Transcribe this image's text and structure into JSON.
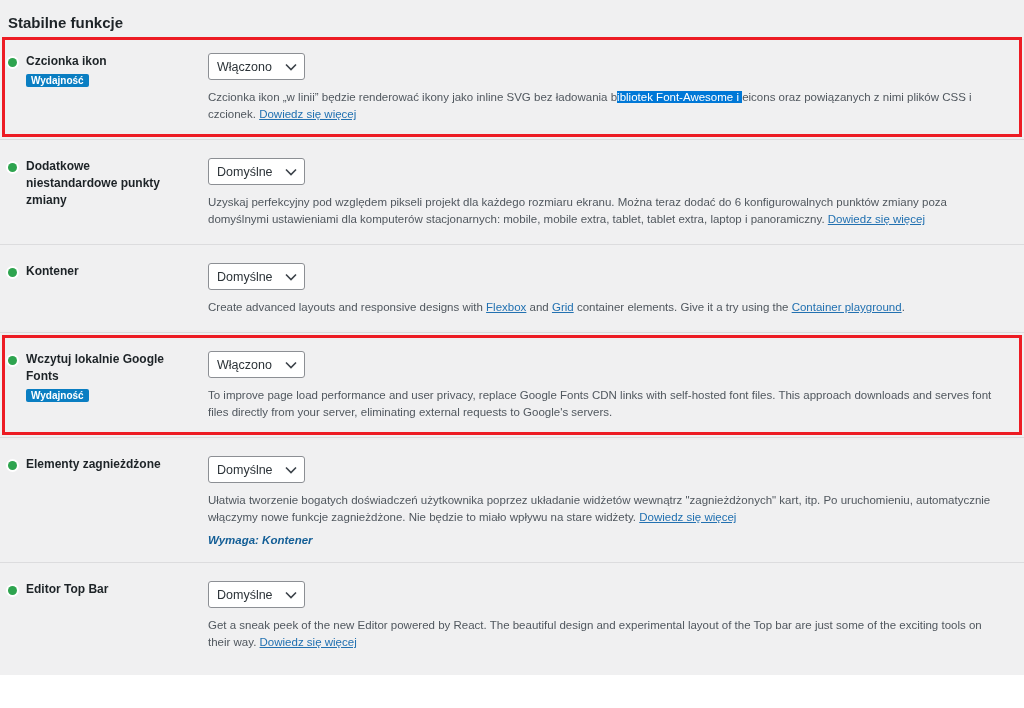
{
  "heading": "Stabilne funkcje",
  "features": [
    {
      "name": "Czcionka ikon",
      "tag": "Wydajność",
      "value": "Włączono",
      "framed": true,
      "description": [
        {
          "kind": "text",
          "text": "Czcionka ikon „w linii” będzie renderować ikony jako inline SVG bez ładowania b"
        },
        {
          "kind": "selection",
          "text": "ibliotek Font-Awesome i "
        },
        {
          "kind": "text",
          "text": "eicons oraz powiązanych z nimi plików CSS i czcionek. "
        },
        {
          "kind": "link",
          "text": "Dowiedz się więcej"
        }
      ]
    },
    {
      "name": "Dodatkowe niestandardowe punkty zmiany",
      "value": "Domyślne",
      "framed": false,
      "description": [
        {
          "kind": "text",
          "text": "Uzyskaj perfekcyjny pod względem pikseli projekt dla każdego rozmiaru ekranu. Można teraz dodać do 6 konfigurowalnych punktów zmiany poza domyślnymi ustawieniami dla komputerów stacjonarnych: mobile, mobile extra, tablet, tablet extra, laptop i panoramiczny. "
        },
        {
          "kind": "link",
          "text": "Dowiedz się więcej"
        }
      ]
    },
    {
      "name": "Kontener",
      "value": "Domyślne",
      "framed": false,
      "description": [
        {
          "kind": "text",
          "text": "Create advanced layouts and responsive designs with "
        },
        {
          "kind": "link",
          "text": "Flexbox"
        },
        {
          "kind": "text",
          "text": " and "
        },
        {
          "kind": "link",
          "text": "Grid"
        },
        {
          "kind": "text",
          "text": " container elements. Give it a try using the "
        },
        {
          "kind": "link",
          "text": "Container playground"
        },
        {
          "kind": "text",
          "text": "."
        }
      ]
    },
    {
      "name": "Wczytuj lokalnie Google Fonts",
      "tag": "Wydajność",
      "value": "Włączono",
      "framed": true,
      "description": [
        {
          "kind": "text",
          "text": "To improve page load performance and user privacy, replace Google Fonts CDN links with self-hosted font files. This approach downloads and serves font files directly from your server, eliminating external requests to Google's servers."
        }
      ]
    },
    {
      "name": "Elementy zagnieżdżone",
      "value": "Domyślne",
      "framed": false,
      "description": [
        {
          "kind": "text",
          "text": "Ułatwia tworzenie bogatych doświadczeń użytkownika poprzez układanie widżetów wewnątrz \"zagnieżdżonych\" kart, itp. Po uruchomieniu, automatycznie włączymy nowe funkcje zagnieżdżone. Nie będzie to miało wpływu na stare widżety. "
        },
        {
          "kind": "link",
          "text": "Dowiedz się więcej"
        }
      ],
      "requires": "Wymaga: Kontener"
    },
    {
      "name": "Editor Top Bar",
      "value": "Domyślne",
      "framed": false,
      "description": [
        {
          "kind": "text",
          "text": "Get a sneak peek of the new Editor powered by React. The beautiful design and experimental layout of the Top bar are just some of the exciting tools on their way. "
        },
        {
          "kind": "link",
          "text": "Dowiedz się więcej"
        }
      ]
    }
  ]
}
